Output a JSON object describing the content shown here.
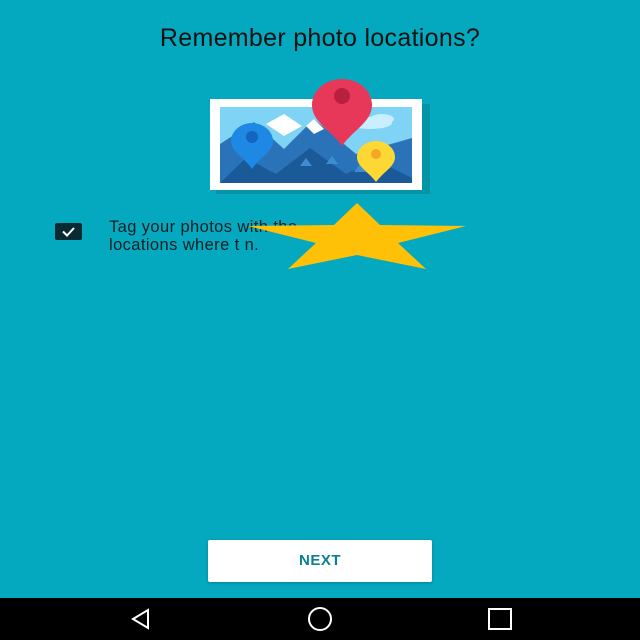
{
  "screen": {
    "title": "Remember photo locations?",
    "checkbox": {
      "checked": true
    },
    "description": {
      "line1": "Tag your photos with the",
      "line2": "locations where t n."
    },
    "overlay": {
      "shape": "star",
      "color": "#FFC107"
    },
    "next_button": {
      "label": "NEXT"
    },
    "colors": {
      "background": "#05A9BF",
      "pin_red": "#E8385A",
      "pin_blue": "#1E88E5",
      "pin_yellow": "#FDD835",
      "button_text": "#0A7F92"
    }
  },
  "navbar": {
    "back": {
      "icon": "back-triangle-icon"
    },
    "home": {
      "icon": "home-circle-icon"
    },
    "recents": {
      "icon": "recents-square-icon"
    }
  }
}
